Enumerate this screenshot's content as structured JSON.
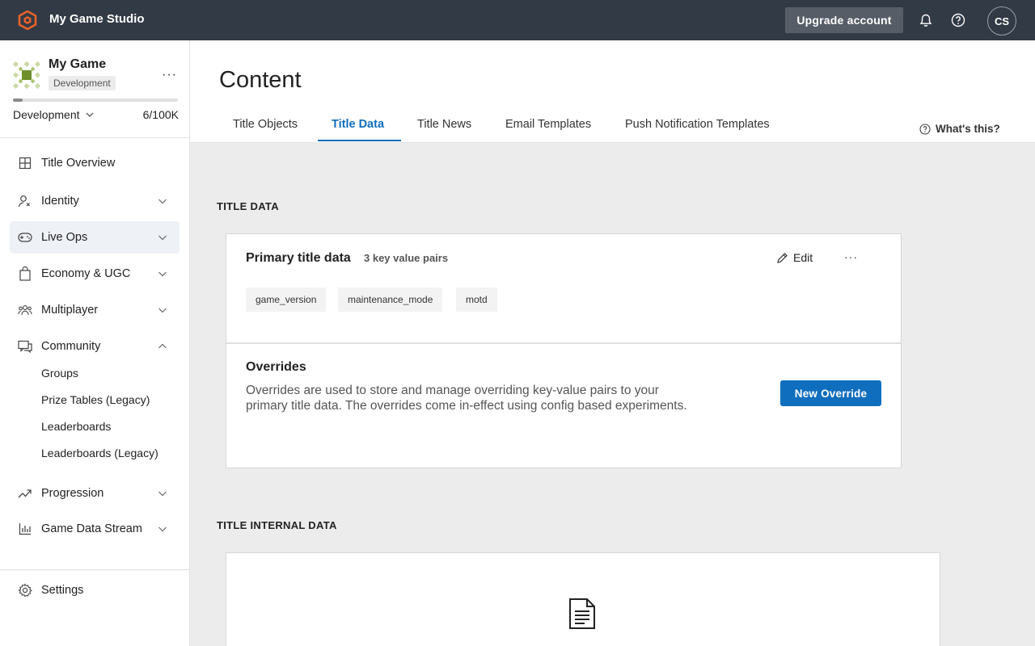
{
  "topbar": {
    "studio_name": "My Game Studio",
    "upgrade_label": "Upgrade account",
    "avatar_initials": "CS",
    "icons": [
      "studio-logo-icon",
      "bell-icon",
      "help-icon"
    ]
  },
  "sidebar": {
    "game_name": "My Game",
    "environment_badge": "Development",
    "environment_select": "Development",
    "usage_count": "6/100K",
    "usage_fraction": 0.06,
    "nav": [
      {
        "label": "Title Overview",
        "icon": "grid-icon"
      },
      {
        "label": "Identity",
        "icon": "identity-icon"
      },
      {
        "label": "Live Ops",
        "icon": "gamepad-icon"
      },
      {
        "label": "Economy & UGC",
        "icon": "shopping-bag-icon"
      },
      {
        "label": "Multiplayer",
        "icon": "people-icon"
      },
      {
        "label": "Community",
        "icon": "chat-icon"
      },
      {
        "label": "Progression",
        "icon": "trend-icon"
      },
      {
        "label": "Game Data Stream",
        "icon": "bar-chart-icon"
      }
    ],
    "community_sub": [
      "Groups",
      "Prize Tables (Legacy)",
      "Leaderboards",
      "Leaderboards (Legacy)"
    ],
    "settings_label": "Settings"
  },
  "main": {
    "page_title": "Content",
    "tabs": [
      {
        "label": "Title Objects"
      },
      {
        "label": "Title Data"
      },
      {
        "label": "Title News"
      },
      {
        "label": "Email Templates"
      },
      {
        "label": "Push Notification Templates"
      }
    ],
    "active_tab": "Title Data",
    "whats_this": "What's this?"
  },
  "title_data": {
    "section_title": "TITLE DATA",
    "card_title": "Primary title data",
    "card_subtitle": "3 key value pairs",
    "edit_label": "Edit",
    "keys": [
      "game_version",
      "maintenance_mode",
      "motd"
    ],
    "overrides_title": "Overrides",
    "overrides_desc": "Overrides are used to store and manage overriding key-value pairs to your primary title data. The overrides come in-effect using config based experiments.",
    "new_override_label": "New Override"
  },
  "title_internal_data": {
    "section_title": "TITLE INTERNAL DATA"
  },
  "colors": {
    "topbar_bg": "#323a45",
    "accent": "#106ebe",
    "main_bg": "#ececec",
    "brand_orange": "#e8622a"
  }
}
